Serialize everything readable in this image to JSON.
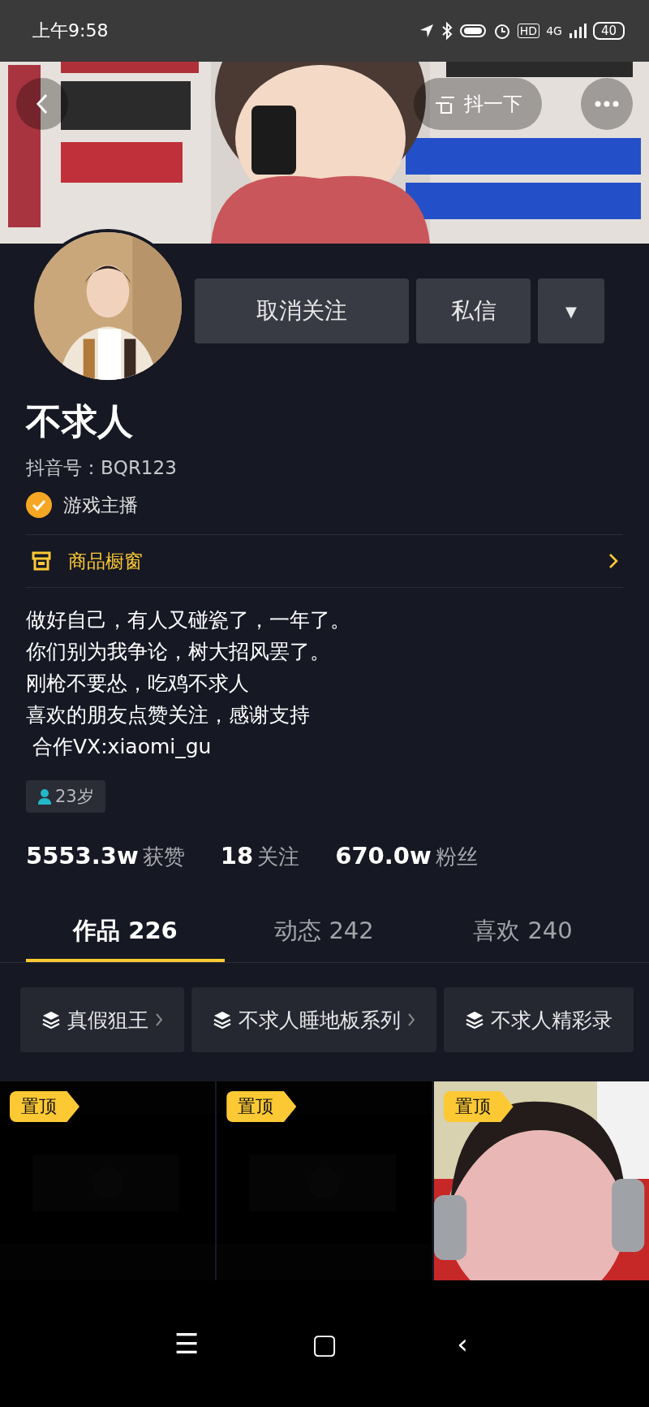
{
  "status_bar": {
    "time": "上午9:58",
    "network": "4G",
    "hd": "HD",
    "battery": "40"
  },
  "header": {
    "kind": "picture",
    "nudge_label": "抖一下"
  },
  "actions": [
    {
      "label": "取消关注",
      "kind": "text"
    },
    {
      "label": "私信",
      "kind": "text"
    },
    {
      "label": "▼",
      "kind": "menu"
    }
  ],
  "profile": {
    "name": "不求人",
    "account_id": "抖音号：BQR123",
    "verified": true,
    "verification": "游戏主播"
  },
  "shop": {
    "label": "商品橱窗"
  },
  "bio": [
    "做好自己，有人又碰瓷了，一年了。",
    "你们别为我争论，树大招风罢了。",
    "刚枪不要怂，吃鸡不求人",
    "喜欢的朋友点赞关注，感谢支持",
    " 合作VX:xiaomi_gu"
  ],
  "age": "23岁",
  "stats": [
    {
      "count": "5553.3w",
      "name": "获赞"
    },
    {
      "count": "18",
      "name": "关注"
    },
    {
      "count": "670.0w",
      "name": "粉丝"
    }
  ],
  "tabs": [
    {
      "label": "作品 226",
      "selected": true
    },
    {
      "label": "动态 242",
      "selected": false
    },
    {
      "label": "喜欢 240",
      "selected": false
    }
  ],
  "collections": [
    {
      "label": "真假狙王"
    },
    {
      "label": "不求人睡地板系列"
    },
    {
      "label": "不求人精彩录"
    }
  ],
  "videos": [
    {
      "pinned": true,
      "pin_label": "置顶",
      "kind": "picture"
    },
    {
      "pinned": true,
      "pin_label": "置顶",
      "kind": "picture"
    },
    {
      "pinned": true,
      "pin_label": "置顶",
      "kind": "picture"
    }
  ],
  "nav": [
    "☰",
    "▢",
    "‹"
  ]
}
